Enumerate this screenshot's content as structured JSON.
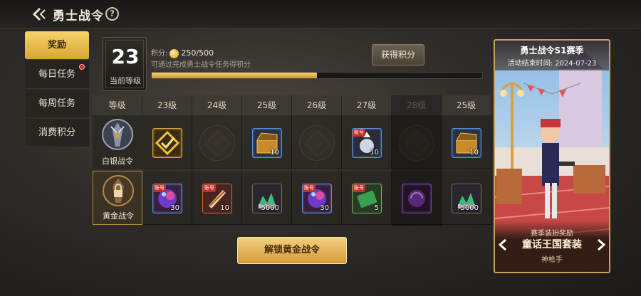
{
  "header": {
    "title": "勇士战令",
    "help": "?"
  },
  "tabs": [
    {
      "label": "奖励",
      "active": true
    },
    {
      "label": "每日任务",
      "active": false,
      "badge": true
    },
    {
      "label": "每周任务",
      "active": false
    },
    {
      "label": "消费积分",
      "active": false
    }
  ],
  "level": {
    "value": "23",
    "label": "当前等级"
  },
  "points": {
    "label": "积分:",
    "value": "250/500",
    "hint": "可通过完成勇士战令任务得积分",
    "progress": 0.5
  },
  "earn_button": "获得积分",
  "grid": {
    "header_label": "等级",
    "columns": [
      "23级",
      "24级",
      "25级",
      "26级",
      "27级",
      "28级",
      "25级"
    ],
    "silver_row_label": "白银战令",
    "gold_row_label": "黄金战令",
    "bind_tag": "账号",
    "silver_counts": [
      "",
      "",
      "10",
      "",
      "10",
      "",
      "10"
    ],
    "gold_counts": [
      "30",
      "10",
      "5000",
      "30",
      "5",
      "",
      "5000"
    ]
  },
  "unlock_button": "解锁黄金战令",
  "season": {
    "title": "勇士战令S1赛季",
    "end_date": "活动结束时间: 2024-07-23",
    "subtitle": "赛季装扮奖励",
    "reward_name": "童话王国套装",
    "class_name": "神枪手"
  },
  "colors": {
    "accent_gold": "#d9a534",
    "panel_dark": "#2e2b28",
    "badge_red": "#d42a2a"
  },
  "icons": [
    "back-arrow-icon",
    "help-icon",
    "coin-icon",
    "chevron-left-icon",
    "chevron-right-icon",
    "lock-icon"
  ]
}
